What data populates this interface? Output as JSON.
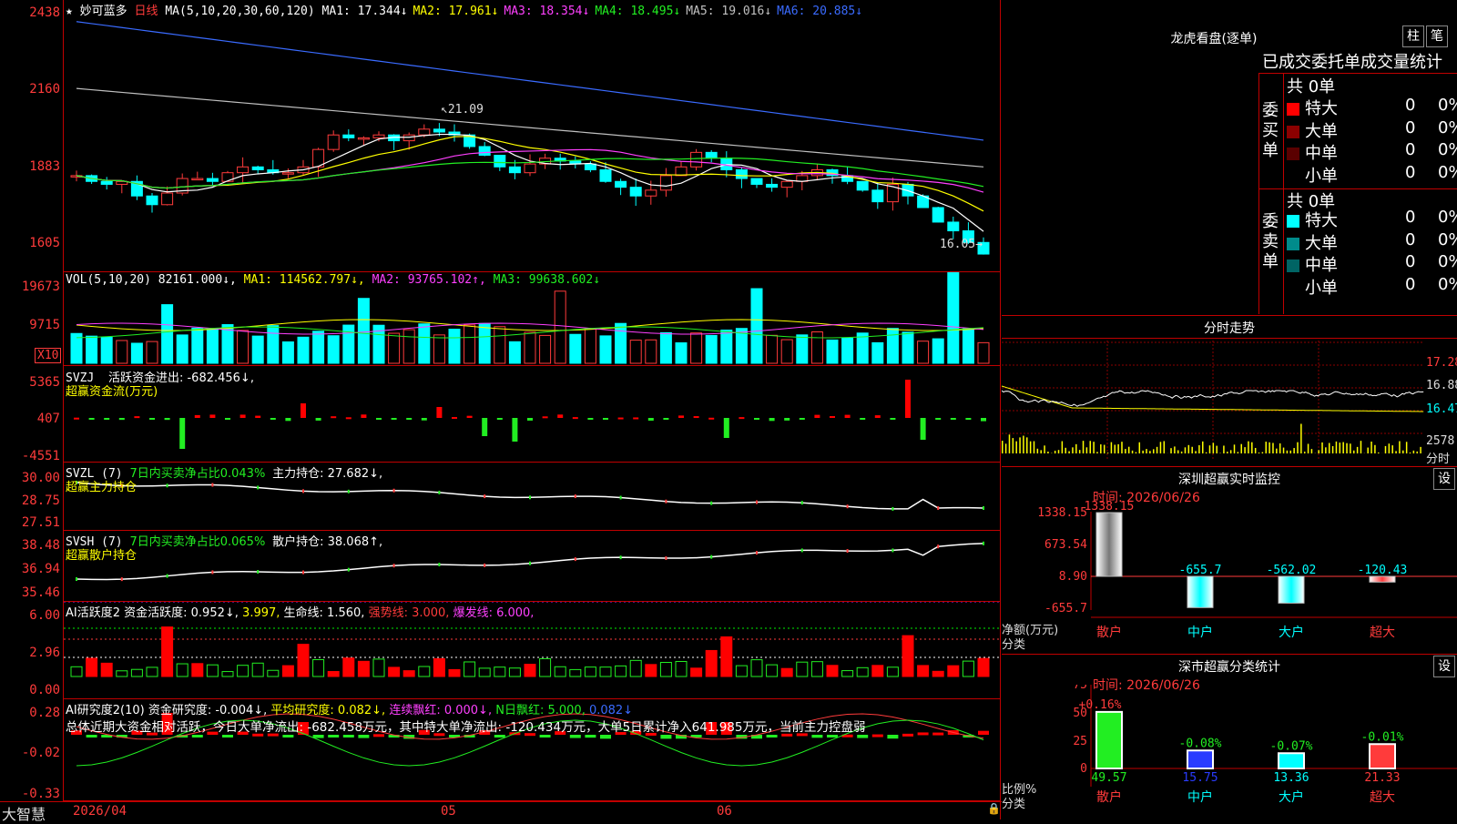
{
  "main": {
    "stock_name": "妙可蓝多",
    "period": "日线",
    "ma_label": "MA(5,10,20,30,60,120)",
    "ma_values": [
      {
        "label": "MA1: 17.344↓",
        "color": "#ffffff"
      },
      {
        "label": "MA2: 17.961↓",
        "color": "#ffff00"
      },
      {
        "label": "MA3: 18.354↓",
        "color": "#ff40ff"
      },
      {
        "label": "MA4: 18.495↓",
        "color": "#22ee22"
      },
      {
        "label": "MA5: 19.016↓",
        "color": "#c0c0c0"
      },
      {
        "label": "MA6: 20.885↓",
        "color": "#3a6bff"
      }
    ],
    "y_ticks": [
      "2438",
      "2160",
      "1883",
      "1605"
    ],
    "high_label": "21.09",
    "low_label": "16.05"
  },
  "vol": {
    "label": "VOL(5,10,20)",
    "value": "82161.000↓,",
    "ma1": "MA1: 114562.797↓,",
    "ma2": "MA2: 93765.102↑,",
    "ma3": "MA3: 99638.602↓",
    "y_ticks": [
      "19673",
      "9715"
    ],
    "unit": "X10"
  },
  "svzj": {
    "label": "SVZJ",
    "text": "活跃资金进出: -682.456↓,",
    "sub": "超赢资金流(万元)",
    "y_ticks": [
      "5365",
      "407",
      "-4551"
    ]
  },
  "svzl": {
    "label": "SVZL (7)",
    "ratio": "7日内买卖净占比0.043%",
    "hold": "主力持仓: 27.682↓,",
    "sub": "超赢主力持仓",
    "y_ticks": [
      "30.00",
      "28.75",
      "27.51"
    ]
  },
  "svsh": {
    "label": "SVSH (7)",
    "ratio": "7日内买卖净占比0.065%",
    "hold": "散户持仓: 38.068↑,",
    "sub": "超赢散户持仓",
    "y_ticks": [
      "38.48",
      "36.94",
      "35.46"
    ]
  },
  "ai1": {
    "label": "AI活跃度2",
    "a": "资金活跃度: 0.952↓,",
    "b": "3.997,",
    "c": "生命线: 1.560,",
    "d": "强势线: 3.000,",
    "e": "爆发线: 6.000,",
    "y_ticks": [
      "6.00",
      "2.96",
      "0.00"
    ]
  },
  "ai2": {
    "label": "AI研究度2(10)",
    "a": "资金研究度: -0.004↓,",
    "b": "平均研究度: 0.082↓,",
    "c": "连续飘红: 0.000↓,",
    "d": "N日飘红: 5.000,",
    "e": "0.082↓",
    "summary": "总体近期大资金相对活跃，今日大单净流出: -682.458万元，其中特大单净流出: -120.434万元，大单5日累计净入641.985万元，当前主力控盘弱",
    "y_ticks": [
      "0.28",
      "-0.02",
      "-0.33"
    ]
  },
  "xaxis": {
    "brand": "大智慧",
    "labels": [
      "2026/04",
      "05",
      "06"
    ]
  },
  "right": {
    "lhb_title": "龙虎看盘(逐单)",
    "btn_zhu": "柱",
    "btn_bi": "笔",
    "stat_title": "已成交委托单成交量统计",
    "buy_label": "委买单",
    "sell_label": "委卖单",
    "buy_total": "共 0单",
    "sell_total": "共 0单",
    "buy_rows": [
      {
        "name": "特大",
        "count": "0",
        "pct": "0%",
        "color": "#ff0000"
      },
      {
        "name": "大单",
        "count": "0",
        "pct": "0%",
        "color": "#8b0000"
      },
      {
        "name": "中单",
        "count": "0",
        "pct": "0%",
        "color": "#5a0000"
      },
      {
        "name": "小单",
        "count": "0",
        "pct": "0%",
        "color": "#000000"
      }
    ],
    "sell_rows": [
      {
        "name": "特大",
        "count": "0",
        "pct": "0%",
        "color": "#00ffff"
      },
      {
        "name": "大单",
        "count": "0",
        "pct": "0%",
        "color": "#008b8b"
      },
      {
        "name": "中单",
        "count": "0",
        "pct": "0%",
        "color": "#006464"
      },
      {
        "name": "小单",
        "count": "0",
        "pct": "0%",
        "color": "#000000"
      }
    ],
    "fs_title": "分时走势",
    "fs_ticks": [
      "17.28",
      "16.88",
      "16.47"
    ],
    "fs_vol": "2578",
    "fs_unit": "分时",
    "mon_title": "深圳超赢实时监控",
    "mon_btn": "设",
    "mon_time": "时间: 2026/06/26",
    "mon_ticks": [
      "1338.15",
      "673.54",
      "8.90",
      "-655.7"
    ],
    "mon_ylabel": "净额(万元)",
    "mon_xlabel": "分类",
    "mon_bars": [
      {
        "name": "散户",
        "value": 1338.15,
        "label": "1338.15"
      },
      {
        "name": "中户",
        "value": -655.7,
        "label": "-655.7"
      },
      {
        "name": "大户",
        "value": -562.02,
        "label": "-562.02"
      },
      {
        "name": "超大",
        "value": -120.43,
        "label": "-120.43"
      }
    ],
    "cls_title": "深市超赢分类统计",
    "cls_btn": "设",
    "cls_time": "时间: 2026/06/26",
    "cls_ticks": [
      "75",
      "50",
      "25",
      "0"
    ],
    "cls_ylabel": "比例%",
    "cls_xlabel": "分类",
    "cls_bars": [
      {
        "name": "散户",
        "pct": 0.16,
        "top": "+0.16%",
        "vol": 49.57,
        "vol_label": "49.57"
      },
      {
        "name": "中户",
        "pct": -0.08,
        "top": "-0.08%",
        "vol": 15.75,
        "vol_label": "15.75"
      },
      {
        "name": "大户",
        "pct": -0.07,
        "top": "-0.07%",
        "vol": 13.36,
        "vol_label": "13.36"
      },
      {
        "name": "超大",
        "pct": -0.01,
        "top": "-0.01%",
        "vol": 21.33,
        "vol_label": "21.33"
      }
    ],
    "colors": {
      "up": "#ff3b3b",
      "down": "#00ffff",
      "frame": "#c00000"
    }
  }
}
